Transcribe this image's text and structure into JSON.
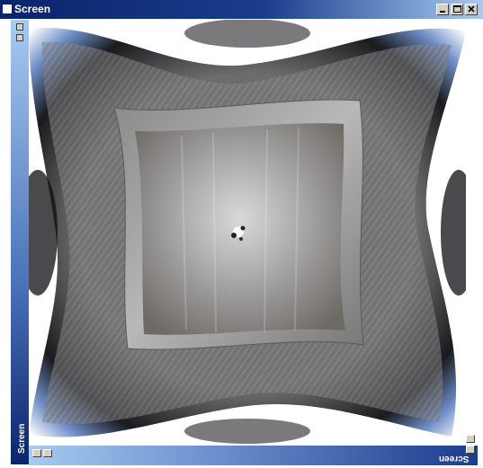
{
  "window": {
    "title": "Screen",
    "buttons": {
      "minimize": "minimize-icon",
      "maximize": "maximize-icon",
      "close": "close-icon"
    }
  },
  "content": {
    "side_caption": "Screen",
    "bottom_caption": "Screen"
  },
  "colors": {
    "titlebar_start": "#0a246a",
    "titlebar_end": "#a6caf0",
    "button_face": "#d4d0c8"
  }
}
